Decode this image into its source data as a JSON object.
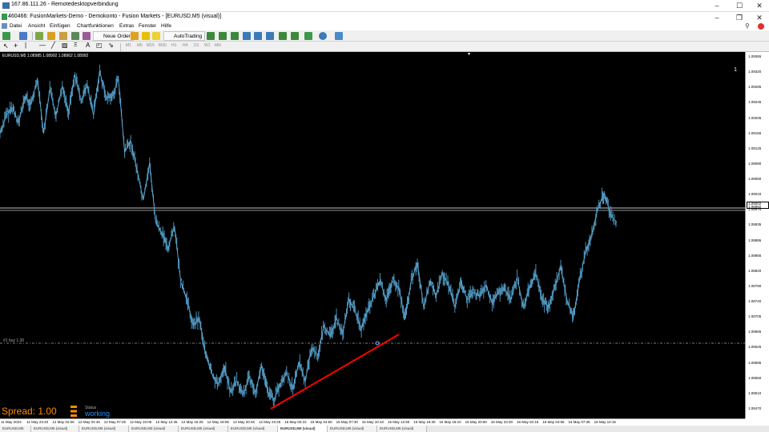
{
  "rdp": {
    "title": "167.86.111.26 - Remotedesktopverbindung"
  },
  "window": {
    "title": "460466: FusionMarkets-Demo - Demokonto - Fusion Markets - [EURUSD,M5 (visual)]"
  },
  "menu": {
    "items": [
      "Datei",
      "Ansicht",
      "Einfügen",
      "Chartfunktionen",
      "Extras",
      "Fenster",
      "Hilfe"
    ]
  },
  "toolbar": {
    "new_order": "Neue Order",
    "autotrading": "AutoTrading"
  },
  "timeframes": [
    "M1",
    "M5",
    "M15",
    "M30",
    "H1",
    "H4",
    "D1",
    "W1",
    "MN"
  ],
  "chart": {
    "symbol_ohlc": "EURUSD,M5  1.08985 1.08992 1.08962 1.08992",
    "spread_label": "Spread: 1.00",
    "status_label": "Status",
    "status_value": "working",
    "order_label": "#1 buy 1.00",
    "position_number": "1",
    "current_price_bid": "1.09002",
    "current_price_ask": "1.08992"
  },
  "price_axis": [
    "1.09365",
    "1.09320",
    "1.09285",
    "1.09245",
    "1.09205",
    "1.09165",
    "1.09125",
    "1.09090",
    "1.09050",
    "1.09015",
    "1.08975",
    "1.08935",
    "1.08895",
    "1.08855",
    "1.08820",
    "1.08780",
    "1.08740",
    "1.08705",
    "1.08665",
    "1.08625",
    "1.08585",
    "1.08550",
    "1.08510",
    "1.08470"
  ],
  "time_axis": [
    "11 May 2023",
    "11 May 23:20",
    "12 May 02:05",
    "12 May 04:45",
    "12 May 07:25",
    "12 May 10:05",
    "12 May 12:45",
    "12 May 15:25",
    "12 May 18:05",
    "12 May 20:45",
    "12 May 23:25",
    "15 May 02:10",
    "15 May 04:50",
    "15 May 07:30",
    "15 May 10:10",
    "15 May 12:50",
    "15 May 15:30",
    "15 May 18:10",
    "15 May 20:50",
    "15 May 23:30",
    "16 May 02:15",
    "16 May 04:55",
    "16 May 07:35",
    "16 May 10:15"
  ],
  "tabs": [
    "EURUSD,M5",
    "EURUSD,M5 (visual)",
    "EURUSD,M5 (visual)",
    "EURUSD,M5 (visual)",
    "EURUSD,M5 (visual)",
    "EURUSD,M5 (visual)",
    "EURUSD,M5 (visual)",
    "EURUSD,M5 (visual)",
    "EURUSD,M5 (visual)"
  ],
  "chart_data": {
    "type": "line",
    "series": [
      {
        "values": [
          1.092,
          1.0925,
          1.0927,
          1.0923,
          1.093,
          1.0928,
          1.0935,
          1.092,
          1.0932,
          1.0925,
          1.0933,
          1.0926,
          1.0936,
          1.0929,
          1.0933,
          1.0925,
          1.0937,
          1.093,
          1.093,
          1.0935,
          1.0915,
          1.0918,
          1.091,
          1.0902,
          1.0912,
          1.0896,
          1.0893,
          1.0889,
          1.0895,
          1.088,
          1.0875,
          1.0868,
          1.087,
          1.086,
          1.0855,
          1.0852,
          1.0857,
          1.085,
          1.0853,
          1.0849,
          1.0854,
          1.085,
          1.0857,
          1.085,
          1.0848,
          1.0852,
          1.0855,
          1.0851,
          1.0858,
          1.0853,
          1.0862,
          1.086,
          1.0868,
          1.0865,
          1.087,
          1.0866,
          1.0875,
          1.0872,
          1.0867,
          1.0872,
          1.0876,
          1.088,
          1.0875,
          1.088,
          1.0878,
          1.087,
          1.088,
          1.0885,
          1.0873,
          1.088,
          1.0876,
          1.0882,
          1.0879,
          1.0873,
          1.088,
          1.0875,
          1.0877,
          1.0876,
          1.0879,
          1.0874,
          1.0877,
          1.0878,
          1.0875,
          1.0881,
          1.0873,
          1.0878,
          1.0882,
          1.0875,
          1.0873,
          1.0878,
          1.0884,
          1.0875,
          1.087,
          1.088,
          1.0888,
          1.0893,
          1.09,
          1.0904,
          1.0898,
          1.0896
        ],
        "color": "#4a90b8"
      }
    ],
    "ylim": [
      1.0845,
      1.094
    ],
    "grid": false
  },
  "colors": {
    "chart_bg": "#000000",
    "price_line": "#4a90b8",
    "trendline": "#ff0000",
    "spread": "#ff8c00",
    "status": "#1e90ff"
  }
}
